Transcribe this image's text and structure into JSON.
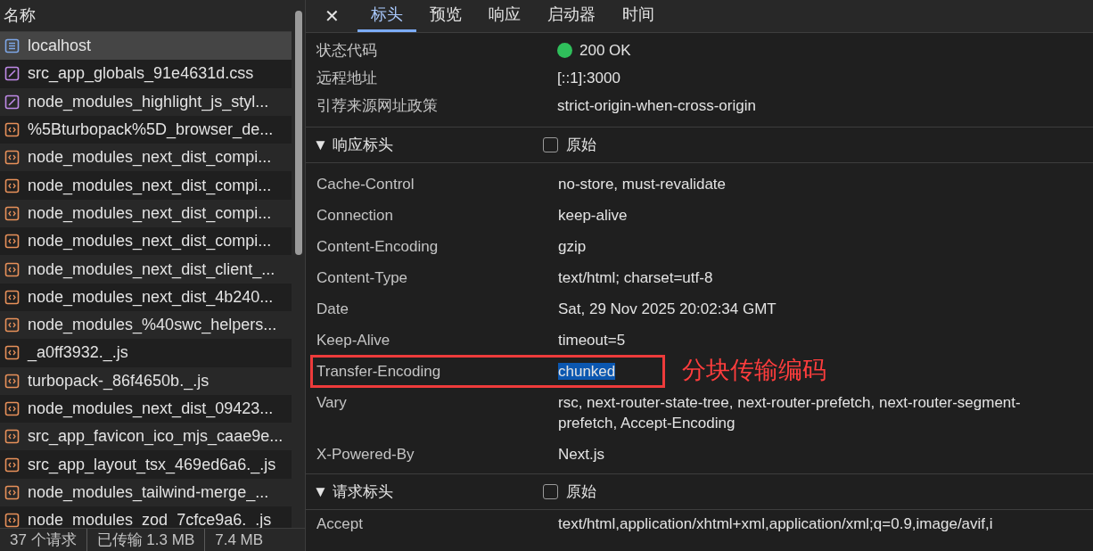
{
  "file_list": {
    "header": "名称",
    "files": [
      {
        "name": "localhost",
        "kind": "document",
        "selected": true
      },
      {
        "name": "src_app_globals_91e4631d.css",
        "kind": "stylesheet",
        "selected": false
      },
      {
        "name": "node_modules_highlight_js_styl...",
        "kind": "stylesheet",
        "selected": false
      },
      {
        "name": "%5Bturbopack%5D_browser_de...",
        "kind": "script",
        "selected": false
      },
      {
        "name": "node_modules_next_dist_compi...",
        "kind": "script",
        "selected": false
      },
      {
        "name": "node_modules_next_dist_compi...",
        "kind": "script",
        "selected": false
      },
      {
        "name": "node_modules_next_dist_compi...",
        "kind": "script",
        "selected": false
      },
      {
        "name": "node_modules_next_dist_compi...",
        "kind": "script",
        "selected": false
      },
      {
        "name": "node_modules_next_dist_client_...",
        "kind": "script",
        "selected": false
      },
      {
        "name": "node_modules_next_dist_4b240...",
        "kind": "script",
        "selected": false
      },
      {
        "name": "node_modules_%40swc_helpers...",
        "kind": "script",
        "selected": false
      },
      {
        "name": "_a0ff3932._.js",
        "kind": "script",
        "selected": false
      },
      {
        "name": "turbopack-_86f4650b._.js",
        "kind": "script",
        "selected": false
      },
      {
        "name": "node_modules_next_dist_09423...",
        "kind": "script",
        "selected": false
      },
      {
        "name": "src_app_favicon_ico_mjs_caae9e...",
        "kind": "script",
        "selected": false
      },
      {
        "name": "src_app_layout_tsx_469ed6a6._.js",
        "kind": "script",
        "selected": false
      },
      {
        "name": "node_modules_tailwind-merge_...",
        "kind": "script",
        "selected": false
      },
      {
        "name": "node_modules_zod_7cfce9a6._.js",
        "kind": "script",
        "selected": false
      }
    ]
  },
  "status_bar": [
    "37 个请求",
    "已传输 1.3 MB",
    "7.4 MB"
  ],
  "detail_tabs": {
    "close": "✕",
    "tabs": [
      {
        "label": "标头",
        "selected": true
      },
      {
        "label": "预览",
        "selected": false
      },
      {
        "label": "响应",
        "selected": false
      },
      {
        "label": "启动器",
        "selected": false
      },
      {
        "label": "时间",
        "selected": false
      }
    ]
  },
  "general": [
    {
      "key": "状态代码",
      "value": "200 OK",
      "color": "#2fbf5b"
    },
    {
      "key": "远程地址",
      "value": "[::1]:3000"
    },
    {
      "key": "引荐来源网址政策",
      "value": "strict-origin-when-cross-origin"
    }
  ],
  "response_headers": {
    "title": "▼ 响应标头",
    "raw_label": "原始",
    "raw_checked": false,
    "rows": [
      {
        "key": "Cache-Control",
        "value": "no-store, must-revalidate",
        "highlighted": false
      },
      {
        "key": "Connection",
        "value": "keep-alive",
        "highlighted": false
      },
      {
        "key": "Content-Encoding",
        "value": "gzip",
        "highlighted": false
      },
      {
        "key": "Content-Type",
        "value": "text/html; charset=utf-8",
        "highlighted": false
      },
      {
        "key": "Date",
        "value": "Sat, 29 Nov 2025 20:02:34 GMT",
        "highlighted": false
      },
      {
        "key": "Keep-Alive",
        "value": "timeout=5",
        "highlighted": false
      },
      {
        "key": "Transfer-Encoding",
        "value": "chunked",
        "highlighted": true,
        "annotation": "分块传输编码"
      },
      {
        "key": "Vary",
        "value": "rsc, next-router-state-tree, next-router-prefetch, next-router-segment-prefetch, Accept-Encoding",
        "highlighted": false
      },
      {
        "key": "X-Powered-By",
        "value": "Next.js",
        "highlighted": false
      }
    ]
  },
  "request_headers": {
    "title": "▼ 请求标头",
    "raw_label": "原始",
    "raw_checked": false,
    "rows": [
      {
        "key": "Accept",
        "value": "text/html,application/xhtml+xml,application/xml;q=0.9,image/avif,i",
        "highlighted": false
      }
    ]
  }
}
